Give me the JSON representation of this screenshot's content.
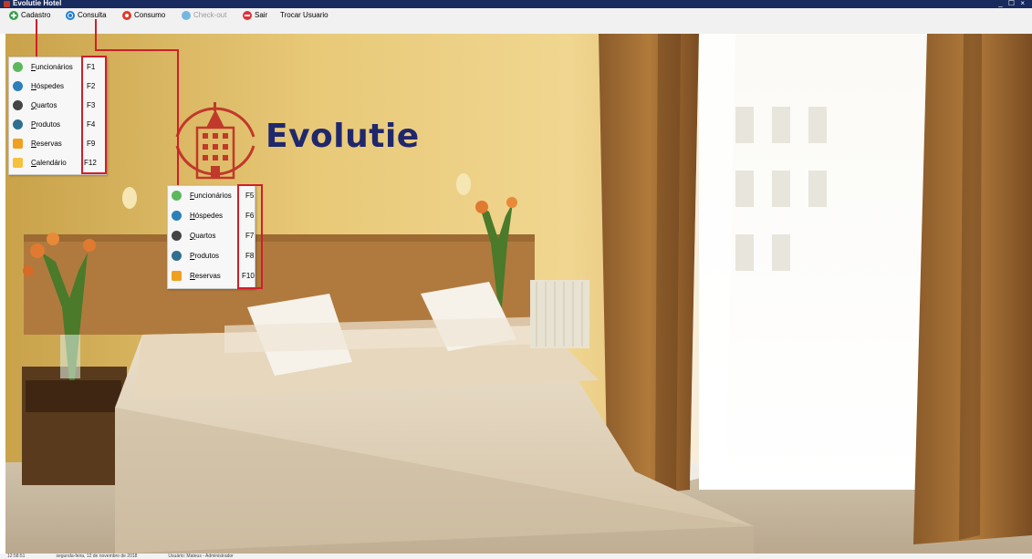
{
  "window": {
    "title": "Evolutie Hotel",
    "controls": "_ ☐ ×"
  },
  "menubar": {
    "items": [
      {
        "label": "Cadastro",
        "icon": "plus-icon",
        "enabled": true
      },
      {
        "label": "Consulta",
        "icon": "search-icon",
        "enabled": true
      },
      {
        "label": "Consumo",
        "icon": "consumption-icon",
        "enabled": true
      },
      {
        "label": "Check-out",
        "icon": "checkout-icon",
        "enabled": false
      },
      {
        "label": "Sair",
        "icon": "exit-icon",
        "enabled": true
      },
      {
        "label": "Trocar Usuario",
        "icon": "",
        "enabled": true
      }
    ]
  },
  "cadastro_menu": {
    "items": [
      {
        "label": "Funcionários",
        "shortcut": "F1",
        "icon": "employees-icon"
      },
      {
        "label": "Hóspedes",
        "shortcut": "F2",
        "icon": "guests-icon"
      },
      {
        "label": "Quartos",
        "shortcut": "F3",
        "icon": "rooms-icon"
      },
      {
        "label": "Produtos",
        "shortcut": "F4",
        "icon": "products-icon"
      },
      {
        "label": "Reservas",
        "shortcut": "F9",
        "icon": "reservations-icon"
      },
      {
        "label": "Calendário",
        "shortcut": "F12",
        "icon": "calendar-icon"
      }
    ]
  },
  "consulta_menu": {
    "items": [
      {
        "label": "Funcionários",
        "shortcut": "F5",
        "icon": "employees-icon"
      },
      {
        "label": "Hóspedes",
        "shortcut": "F6",
        "icon": "guests-icon"
      },
      {
        "label": "Quartos",
        "shortcut": "F7",
        "icon": "rooms-icon"
      },
      {
        "label": "Produtos",
        "shortcut": "F8",
        "icon": "products-icon"
      },
      {
        "label": "Reservas",
        "shortcut": "F10",
        "icon": "reservations-icon"
      }
    ]
  },
  "logo": {
    "text": "Evolutie"
  },
  "status": {
    "time": "12:58:51",
    "date": "segunda-feira, 12 de novembro de 2018",
    "user": "Usuário: Mateus - Administrador"
  },
  "colors": {
    "titlebar": "#182a5e",
    "highlight": "#d01f2a",
    "logo_text": "#20286c",
    "logo_red": "#c0392b"
  }
}
